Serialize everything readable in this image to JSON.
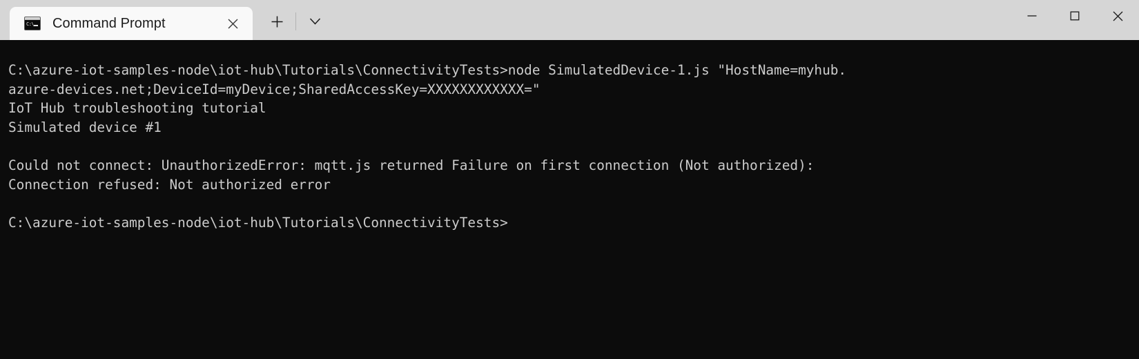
{
  "window": {
    "app_title": "Command Prompt",
    "background_color": "#0c0c0c",
    "titlebar_color": "#d6d6d6",
    "tab_color": "#f9f9f9",
    "text_color": "#cccccc"
  },
  "tabbar": {
    "tabs": [
      {
        "label": "Command Prompt",
        "icon": "command-prompt-icon",
        "icon_prompt_text": "C:\\",
        "active": true,
        "close_label": "Close tab"
      }
    ],
    "new_tab_label": "+",
    "dropdown_label": "v"
  },
  "caption": {
    "minimize_label": "Minimize",
    "maximize_label": "Maximize",
    "close_label": "Close"
  },
  "terminal": {
    "prompt_path": "C:\\azure-iot-samples-node\\iot-hub\\Tutorials\\ConnectivityTests>",
    "lines": [
      "C:\\azure-iot-samples-node\\iot-hub\\Tutorials\\ConnectivityTests>node SimulatedDevice-1.js \"HostName=myhub.",
      "azure-devices.net;DeviceId=myDevice;SharedAccessKey=XXXXXXXXXXXX=\"",
      "IoT Hub troubleshooting tutorial",
      "Simulated device #1",
      "",
      "Could not connect: UnauthorizedError: mqtt.js returned Failure on first connection (Not authorized):",
      "Connection refused: Not authorized error",
      "",
      "C:\\azure-iot-samples-node\\iot-hub\\Tutorials\\ConnectivityTests>"
    ]
  }
}
